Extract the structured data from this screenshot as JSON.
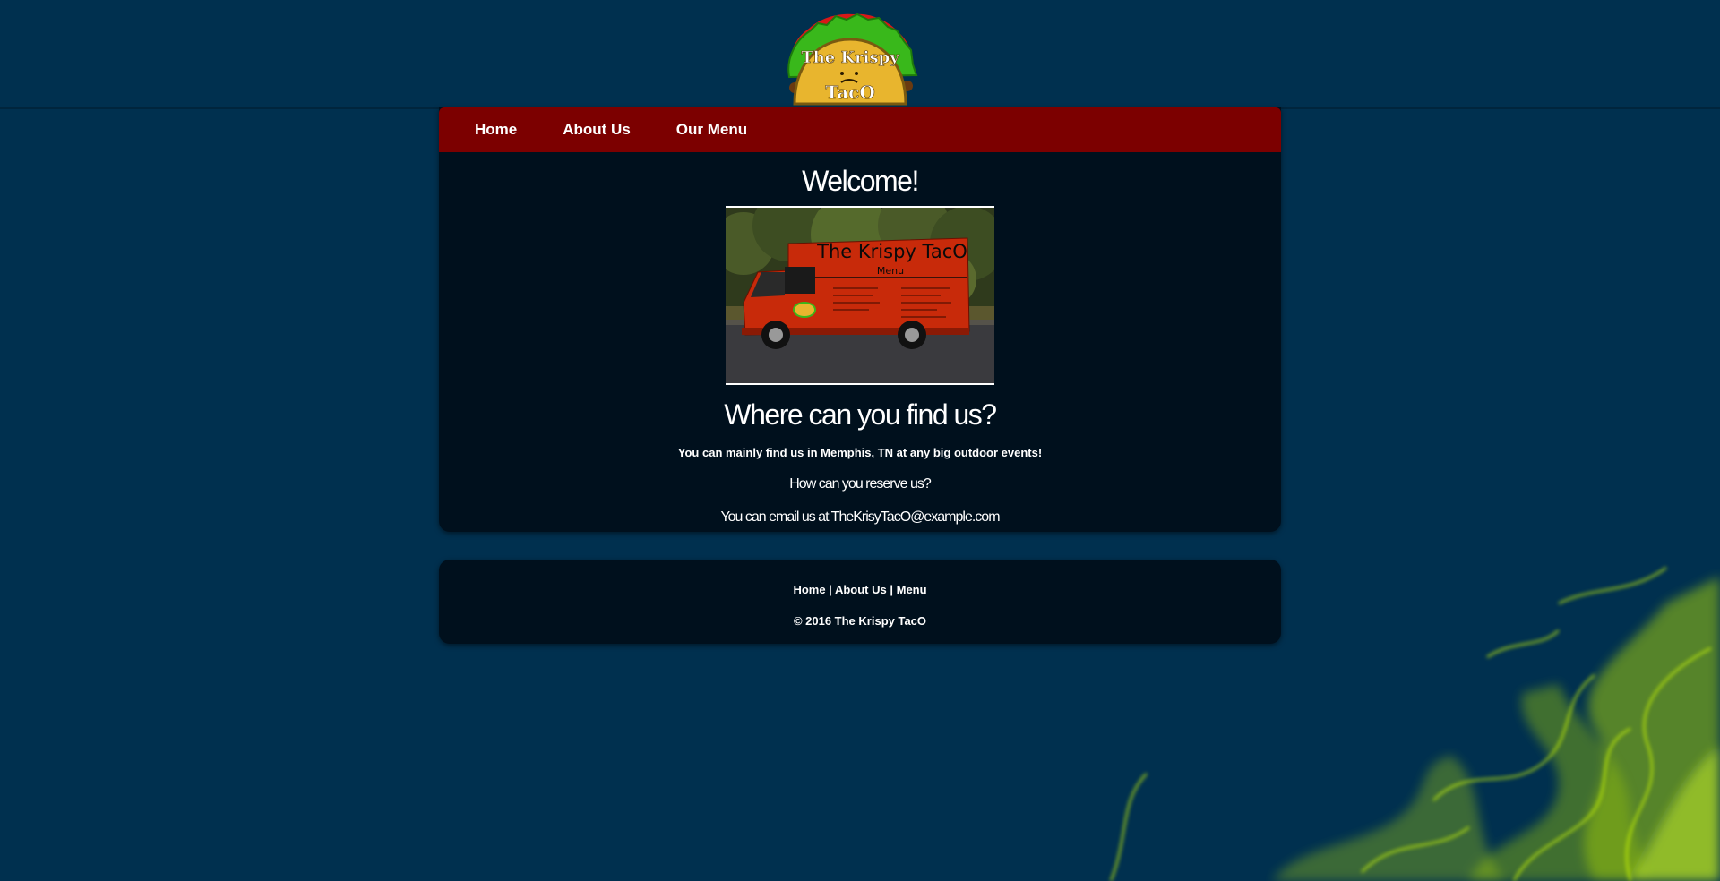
{
  "logo": {
    "line1": "The Krispy",
    "line2": "TacO"
  },
  "nav": {
    "items": [
      {
        "label": "Home"
      },
      {
        "label": "About Us"
      },
      {
        "label": "Our Menu"
      }
    ]
  },
  "main": {
    "welcome_heading": "Welcome!",
    "truck_image": {
      "sign_title": "The Krispy TacO",
      "sign_subtitle": "Menu"
    },
    "where_heading": "Where can you find us?",
    "find_text": "You can mainly find us in Memphis, TN at any big outdoor events!",
    "reserve_question": "How can you reserve us?",
    "email_text": "You can email us at TheKrisyTacO@example.com"
  },
  "footer": {
    "links": [
      {
        "label": "Home"
      },
      {
        "label": "About Us"
      },
      {
        "label": "Menu"
      }
    ],
    "separator": " | ",
    "copyright": "© 2016 The Krispy TacO"
  },
  "colors": {
    "background": "#00304f",
    "panel": "#00101d",
    "nav": "#7c0000",
    "smoke": "#c8f000"
  }
}
